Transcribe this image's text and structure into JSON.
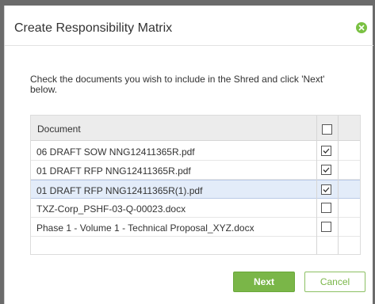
{
  "dialog": {
    "title": "Create Responsibility Matrix",
    "close_icon": "close-icon",
    "instructions": "Check the documents you wish to include in the Shred and click 'Next' below."
  },
  "table": {
    "header": "Document",
    "header_checked": false,
    "rows": [
      {
        "name": "06 DRAFT SOW NNG12411365R.pdf",
        "checked": true,
        "selected": false
      },
      {
        "name": "01 DRAFT RFP NNG12411365R.pdf",
        "checked": true,
        "selected": false
      },
      {
        "name": "01 DRAFT RFP NNG12411365R(1).pdf",
        "checked": true,
        "selected": true
      },
      {
        "name": "TXZ-Corp_PSHF-03-Q-00023.docx",
        "checked": false,
        "selected": false
      },
      {
        "name": "Phase 1 - Volume 1 - Technical Proposal_XYZ.docx",
        "checked": false,
        "selected": false
      }
    ]
  },
  "buttons": {
    "next": "Next",
    "cancel": "Cancel"
  },
  "colors": {
    "accent": "#7ab648",
    "selected_row": "#e3ecf9",
    "backdrop": "#6b6b6b"
  }
}
